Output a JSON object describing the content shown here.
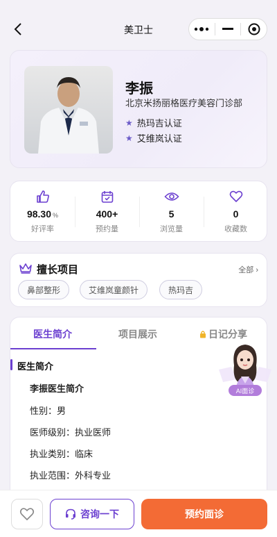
{
  "nav": {
    "title": "美卫士"
  },
  "doctor": {
    "name": "李振",
    "clinic": "北京米扬丽格医疗美容门诊部",
    "certs": [
      "热玛吉认证",
      "艾维岚认证"
    ]
  },
  "stats": [
    {
      "icon": "thumbs-up-icon",
      "value": "98.30",
      "unit": "%",
      "label": "好评率"
    },
    {
      "icon": "calendar-check-icon",
      "value": "400+",
      "unit": "",
      "label": "预约量"
    },
    {
      "icon": "eye-icon",
      "value": "5",
      "unit": "",
      "label": "浏览量"
    },
    {
      "icon": "heart-icon",
      "value": "0",
      "unit": "",
      "label": "收藏数"
    }
  ],
  "skills": {
    "title": "擅长项目",
    "all": "全部 ›",
    "tags": [
      "鼻部整形",
      "艾维岚童颜针",
      "热玛吉"
    ]
  },
  "tabs": [
    "医生简介",
    "项目展示",
    "日记分享"
  ],
  "intro": {
    "section_title": "医生简介",
    "heading": "李振医生简介",
    "lines": [
      "性别：男",
      "医师级别：执业医师",
      "执业类别：临床",
      "执业范围：外科专业"
    ]
  },
  "ai": {
    "badge": "AI面诊"
  },
  "bottom": {
    "consult": "咨询一下",
    "book": "预约面诊"
  },
  "colors": {
    "accent": "#6b3fd0",
    "cta": "#f36b35"
  }
}
